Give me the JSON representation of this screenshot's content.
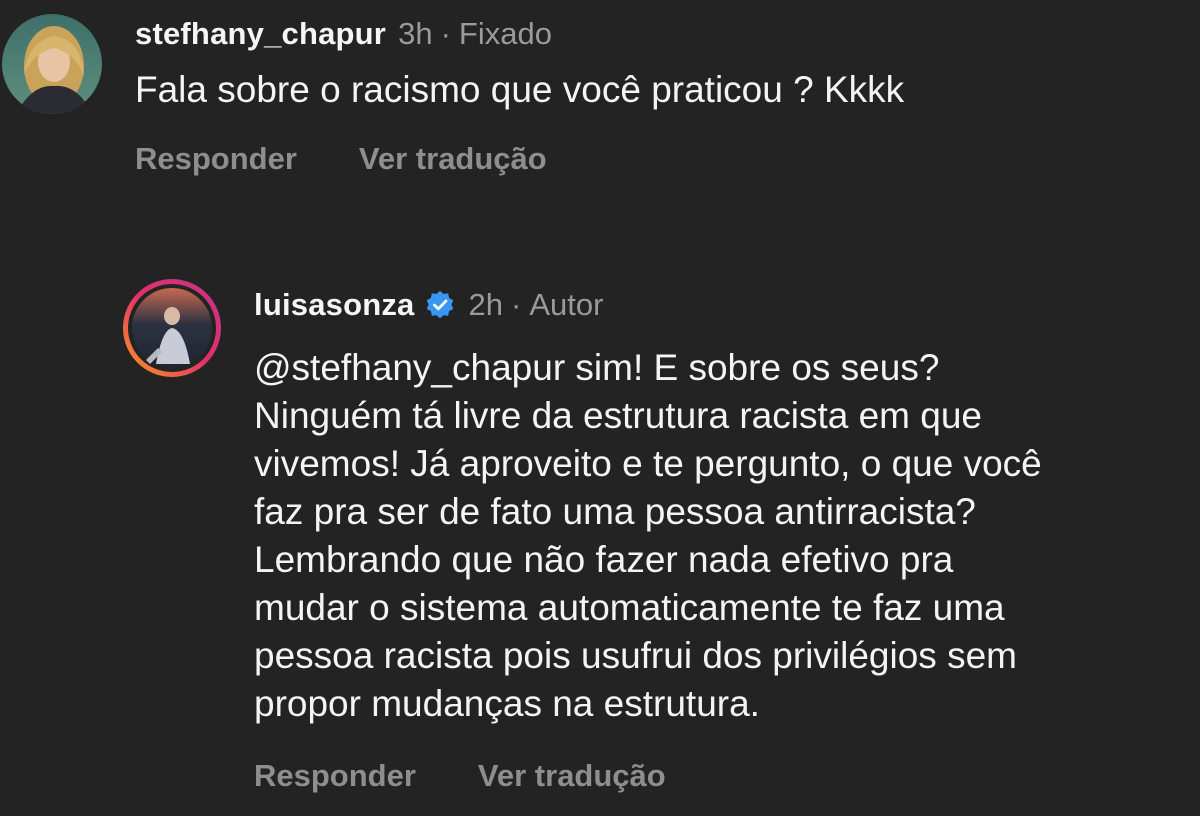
{
  "comments": [
    {
      "username": "stefhany_chapur",
      "time": "3h",
      "separator": "·",
      "tag": "Fixado",
      "text_lines": [
        "Fala sobre o racismo que você praticou ? Kkkk"
      ],
      "reply_label": "Responder",
      "translate_label": "Ver tradução"
    },
    {
      "username": "luisasonza",
      "verified": true,
      "time": "2h",
      "separator": "·",
      "tag": "Autor",
      "text_lines": [
        "@stefhany_chapur sim! E sobre os seus?",
        "Ninguém tá livre da estrutura racista em que",
        "vivemos! Já aproveito e te pergunto, o que você",
        "faz pra ser de fato uma pessoa antirracista?",
        "Lembrando que não fazer nada efetivo pra",
        "mudar o sistema automaticamente te faz uma",
        "pessoa racista pois usufrui dos privilégios sem",
        "propor mudanças na estrutura."
      ],
      "reply_label": "Responder",
      "translate_label": "Ver tradução"
    }
  ],
  "colors": {
    "background": "#232323",
    "text": "#f4f4f4",
    "secondary": "#9a9a9a",
    "verified_badge": "#3897f0",
    "story_ring_start": "#f9a01b",
    "story_ring_end": "#c13584"
  },
  "icons": {
    "verified": "verified-badge-icon"
  }
}
